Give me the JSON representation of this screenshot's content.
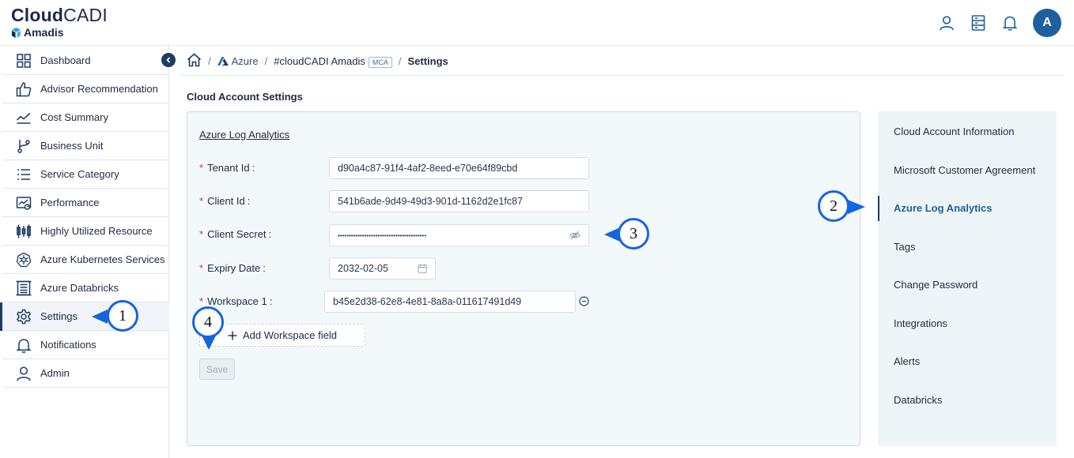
{
  "header": {
    "logo_bold": "Cloud",
    "logo_light": "CADI",
    "logo_sub": "Amadis",
    "avatar_letter": "A",
    "icons": [
      "user-icon",
      "server-icon",
      "bell-icon"
    ]
  },
  "sidebar": {
    "items": [
      {
        "label": "Dashboard",
        "icon": "dashboard-icon"
      },
      {
        "label": "Advisor Recommendation",
        "icon": "thumbs-up-icon"
      },
      {
        "label": "Cost Summary",
        "icon": "line-chart-icon"
      },
      {
        "label": "Business Unit",
        "icon": "branch-icon"
      },
      {
        "label": "Service Category",
        "icon": "list-icon"
      },
      {
        "label": "Performance",
        "icon": "performance-icon"
      },
      {
        "label": "Highly Utilized Resource",
        "icon": "candlestick-icon"
      },
      {
        "label": "Azure Kubernetes Services",
        "icon": "kubernetes-icon"
      },
      {
        "label": "Azure Databricks",
        "icon": "databricks-icon"
      },
      {
        "label": "Settings",
        "icon": "gear-icon",
        "active": true
      },
      {
        "label": "Notifications",
        "icon": "bell-icon"
      },
      {
        "label": "Admin",
        "icon": "user-icon"
      }
    ]
  },
  "breadcrumb": {
    "azure": "Azure",
    "account": "#cloudCADI Amadis",
    "badge": "MCA",
    "current": "Settings",
    "separator": "/"
  },
  "page_title": "Cloud Account Settings",
  "form": {
    "heading": "Azure Log Analytics",
    "required_mark": "*",
    "tenant_label": "Tenant Id",
    "tenant_value": "d90a4c87-91f4-4af2-8eed-e70e64f89cbd",
    "client_label": "Client Id",
    "client_value": "541b6ade-9d49-49d3-901d-1162d2e1fc87",
    "secret_label": "Client Secret",
    "secret_value": "••••••••••••••••••••••••••••••••••••••••",
    "expiry_label": "Expiry Date",
    "expiry_value": "2032-02-05",
    "workspace_label": "Workspace 1",
    "workspace_value": "b45e2d38-62e8-4e81-8a8a-011617491d49",
    "colon": ":",
    "add_workspace": "Add Workspace field",
    "save": "Save"
  },
  "right_nav": {
    "items": [
      {
        "label": "Cloud Account Information"
      },
      {
        "label": "Microsoft Customer Agreement"
      },
      {
        "label": "Azure Log Analytics",
        "active": true
      },
      {
        "label": "Tags"
      },
      {
        "label": "Change Password"
      },
      {
        "label": "Integrations"
      },
      {
        "label": "Alerts"
      },
      {
        "label": "Databricks"
      }
    ]
  },
  "callouts": [
    "1",
    "2",
    "3",
    "4"
  ],
  "colors": {
    "callout": "#1565e0",
    "active_nav": "#1f5f9a",
    "primary_dark": "#1f3b64",
    "required": "#d9363e"
  }
}
